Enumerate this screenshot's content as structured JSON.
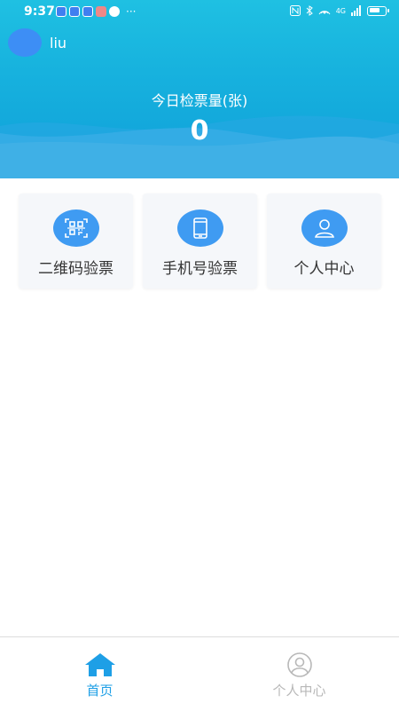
{
  "status_bar": {
    "time": "9:37",
    "dots": "···",
    "network": "4G",
    "icons": [
      "mail-icon",
      "cloud-icon",
      "app-icon",
      "book-icon",
      "chat-icon",
      "nfc-icon",
      "bluetooth-icon",
      "hotspot-icon",
      "signal-icon",
      "battery-icon"
    ]
  },
  "user": {
    "name": "liu"
  },
  "stats": {
    "label": "今日检票量(张)",
    "value": "0"
  },
  "actions": [
    {
      "label": "二维码验票",
      "icon": "qr-code-icon"
    },
    {
      "label": "手机号验票",
      "icon": "phone-icon"
    },
    {
      "label": "个人中心",
      "icon": "user-icon"
    }
  ],
  "tabs": [
    {
      "label": "首页",
      "icon": "home-icon",
      "active": true
    },
    {
      "label": "个人中心",
      "icon": "user-circle-icon",
      "active": false
    }
  ],
  "colors": {
    "header_top": "#1fc0e2",
    "header_bottom": "#0f9fd9",
    "icon_circle": "#3f9bf2",
    "tab_active": "#1e9fe6",
    "tab_inactive": "#b8b8b8"
  }
}
